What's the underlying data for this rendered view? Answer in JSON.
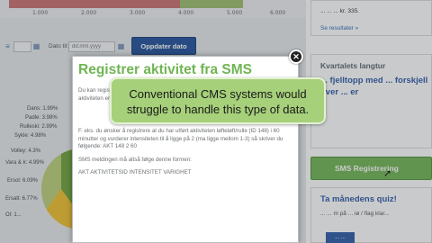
{
  "chart": {
    "ticks": [
      "1.000",
      "2.000",
      "3.000",
      "4.000",
      "5.000",
      "6.000"
    ]
  },
  "filters": {
    "date_label": "Dato til:",
    "date_placeholder": "dd.mm.yyyy",
    "update_button": "Oppdater dato"
  },
  "legend": [
    "Dans: 1.99%",
    "Padle: 3.98%",
    "Rulleski: 2.99%",
    "Sykle: 4.98%",
    "Volley: 4.3%",
    "Vara & k: 4.99%",
    "Ersol: 6.09%",
    "Ersalt: 6.77%",
    "Ol: 1..."
  ],
  "right": {
    "top_text": "... ... ... kr. 335.",
    "top_link": "Se resultater »",
    "quarter_heading": "Kvartalets langtur",
    "quarter_text": "... fjelltopp med ... forskjell over ... er",
    "sms_button": "SMS Registrering",
    "quiz_heading": "Ta månedens quiz!",
    "quiz_sub": "... ... m på ... iø / flag klar...",
    "quiz_tag": "... ..."
  },
  "modal": {
    "title": "Registrer aktivitet fra SMS",
    "lines": [
      "Du kan registrere aktiviteter ved hjelp av SMS. Du vil da motta en bekreftelse på at aktiviteten er registrert.",
      "F. eks. du ønsker å registrere at du har utført aktiviteten løfteløft/rulle (ID 148) i 60 minutter og vurderer intensiteten til å ligge på 2 (ma ligge mellom 1-3) så skriver du følgende: AKT 148 2 60",
      "SMS meldingen må altså følge denne formen:",
      "AKT AKTIVITETSID INTENSITET VARIGHET"
    ]
  },
  "callout": {
    "text": "Conventional CMS systems would struggle to handle this type of data."
  },
  "colors": {
    "accent_green": "#6fb552",
    "link_blue": "#2b5aa8",
    "button_blue": "#1f4f9a",
    "callout_green": "#a6d07a"
  }
}
